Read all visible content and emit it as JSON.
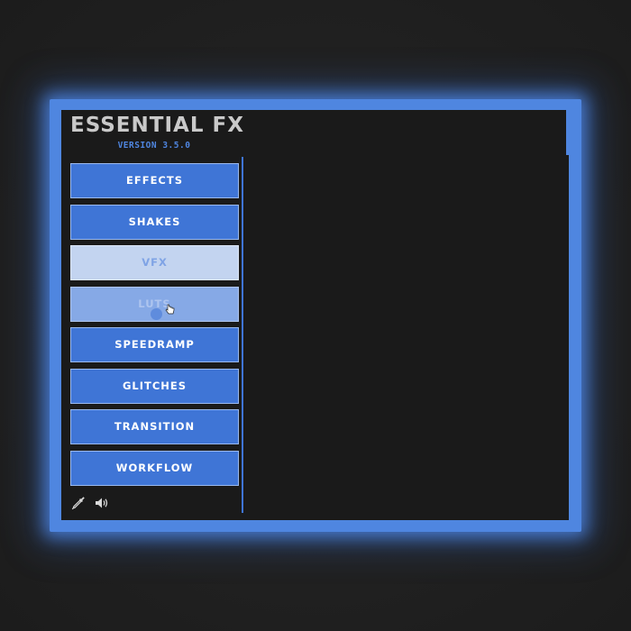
{
  "app": {
    "title": "ESSENTIAL FX",
    "version": "VERSION 3.5.0"
  },
  "menu": {
    "items": [
      {
        "label": "EFFECTS",
        "state": "normal"
      },
      {
        "label": "SHAKES",
        "state": "normal"
      },
      {
        "label": "VFX",
        "state": "pressed"
      },
      {
        "label": "LUTS",
        "state": "hover"
      },
      {
        "label": "SPEEDRAMP",
        "state": "normal"
      },
      {
        "label": "GLITCHES",
        "state": "normal"
      },
      {
        "label": "TRANSITION",
        "state": "normal"
      },
      {
        "label": "WORKFLOW",
        "state": "normal"
      }
    ]
  },
  "footer": {
    "icons": [
      "eyedropper-icon",
      "speaker-icon"
    ]
  },
  "colors": {
    "accent": "#3f75d6",
    "frame": "#4f86e0",
    "panel_bg": "#1a1a1a",
    "title_text": "#c9c9c9"
  }
}
